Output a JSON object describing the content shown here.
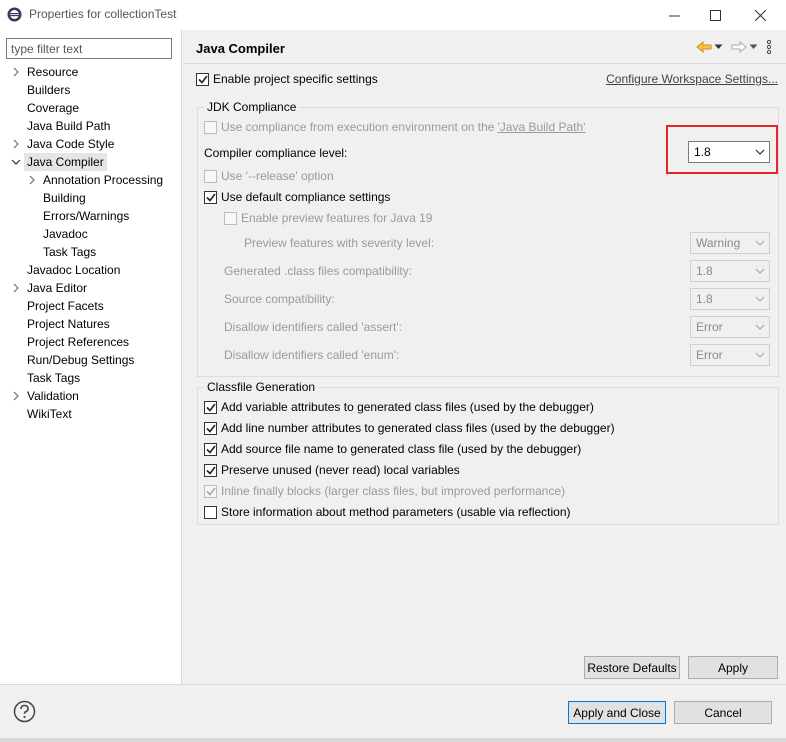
{
  "window": {
    "title": "Properties for collectionTest",
    "icons": [
      "app-icon",
      "minimize-icon",
      "maximize-icon",
      "close-icon"
    ]
  },
  "filter": {
    "placeholder": "type filter text",
    "value": ""
  },
  "tree": {
    "items": [
      {
        "label": "Resource",
        "expander": "collapsed"
      },
      {
        "label": "Builders",
        "expander": "none"
      },
      {
        "label": "Coverage",
        "expander": "none"
      },
      {
        "label": "Java Build Path",
        "expander": "none"
      },
      {
        "label": "Java Code Style",
        "expander": "collapsed"
      },
      {
        "label": "Java Compiler",
        "expander": "expanded",
        "selected": true
      },
      {
        "label": "Annotation Processing",
        "expander": "collapsed",
        "child": true
      },
      {
        "label": "Building",
        "expander": "none",
        "child": true
      },
      {
        "label": "Errors/Warnings",
        "expander": "none",
        "child": true
      },
      {
        "label": "Javadoc",
        "expander": "none",
        "child": true
      },
      {
        "label": "Task Tags",
        "expander": "none",
        "child": true
      },
      {
        "label": "Javadoc Location",
        "expander": "none"
      },
      {
        "label": "Java Editor",
        "expander": "collapsed"
      },
      {
        "label": "Project Facets",
        "expander": "none"
      },
      {
        "label": "Project Natures",
        "expander": "none"
      },
      {
        "label": "Project References",
        "expander": "none"
      },
      {
        "label": "Run/Debug Settings",
        "expander": "none"
      },
      {
        "label": "Task Tags",
        "expander": "none"
      },
      {
        "label": "Validation",
        "expander": "collapsed"
      },
      {
        "label": "WikiText",
        "expander": "none"
      }
    ]
  },
  "page": {
    "title": "Java Compiler",
    "nav_icons": [
      "back-arrow-icon",
      "dropdown-icon",
      "forward-arrow-icon",
      "dropdown-icon",
      "more-vertical-icon"
    ],
    "enable_project_specific": {
      "label": "Enable project specific settings",
      "checked": true
    },
    "configure_link": "Configure Workspace Settings...",
    "jdk": {
      "group_title": "JDK Compliance",
      "use_exec_env": {
        "label_prefix": "Use compliance from execution environment on the ",
        "link": "'Java Build Path'",
        "checked": false
      },
      "compliance_label": "Compiler compliance level:",
      "compliance_value": "1.8",
      "use_release": {
        "label": "Use '--release' option",
        "checked": false
      },
      "use_default": {
        "label": "Use default compliance settings",
        "checked": true
      },
      "enable_preview": {
        "label": "Enable preview features for Java 19",
        "checked": false
      },
      "preview_severity": {
        "label": "Preview features with severity level:",
        "value": "Warning"
      },
      "generated_compat": {
        "label": "Generated .class files compatibility:",
        "value": "1.8"
      },
      "source_compat": {
        "label": "Source compatibility:",
        "value": "1.8"
      },
      "assert_ids": {
        "label": "Disallow identifiers called 'assert':",
        "value": "Error"
      },
      "enum_ids": {
        "label": "Disallow identifiers called 'enum':",
        "value": "Error"
      }
    },
    "classfile": {
      "group_title": "Classfile Generation",
      "options": [
        {
          "label": "Add variable attributes to generated class files (used by the debugger)",
          "checked": true,
          "disabled": false
        },
        {
          "label": "Add line number attributes to generated class files (used by the debugger)",
          "checked": true,
          "disabled": false
        },
        {
          "label": "Add source file name to generated class file (used by the debugger)",
          "checked": true,
          "disabled": false
        },
        {
          "label": "Preserve unused (never read) local variables",
          "checked": true,
          "disabled": false
        },
        {
          "label": "Inline finally blocks (larger class files, but improved performance)",
          "checked": true,
          "disabled": true
        },
        {
          "label": "Store information about method parameters (usable via reflection)",
          "checked": false,
          "disabled": false
        }
      ]
    },
    "restore_defaults": "Restore Defaults",
    "apply": "Apply"
  },
  "footer": {
    "help_icon": "help-icon",
    "apply_close": "Apply and Close",
    "cancel": "Cancel"
  },
  "colors": {
    "highlight_box": "#e8232a",
    "default_button_border": "#0078d7",
    "back_arrow": "#e8a200"
  }
}
